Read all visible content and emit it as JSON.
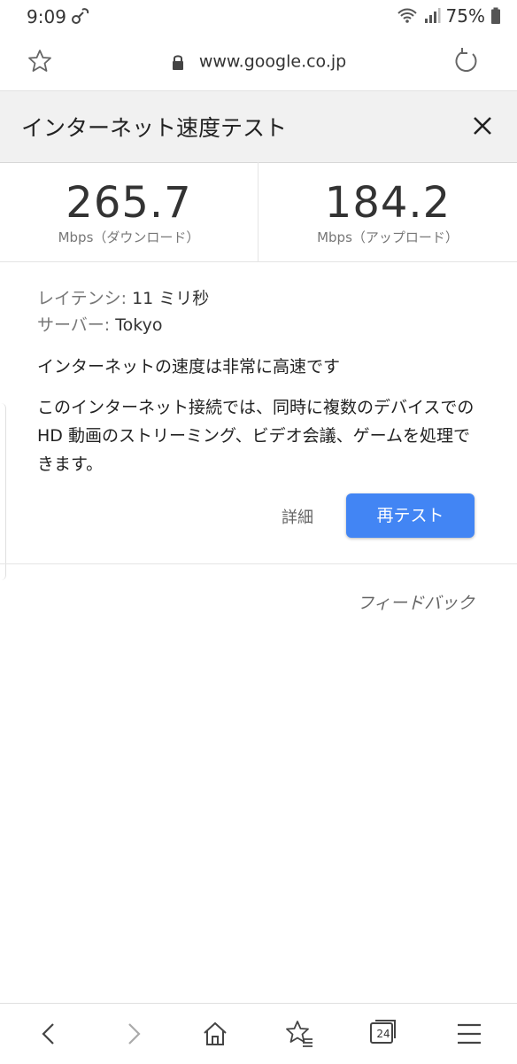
{
  "status_bar": {
    "time": "9:09",
    "battery": "75%"
  },
  "browser": {
    "url": "www.google.co.jp",
    "tab_count": "24"
  },
  "speed_test": {
    "title": "インターネット速度テスト",
    "download": {
      "value": "265.7",
      "label": "Mbps（ダウンロード）"
    },
    "upload": {
      "value": "184.2",
      "label": "Mbps（アップロード）"
    },
    "latency": {
      "key": "レイテンシ:",
      "value": " 11 ミリ秒"
    },
    "server": {
      "key": "サーバー:",
      "value": " Tokyo"
    },
    "rating": "インターネットの速度は非常に高速です",
    "description": "このインターネット接続では、同時に複数のデバイスでのHD 動画のストリーミング、ビデオ会議、ゲームを処理できます。",
    "details_label": "詳細",
    "retest_label": "再テスト",
    "feedback_label": "フィードバック"
  },
  "colors": {
    "accent": "#4285f4",
    "title_band": "#f1f1f1"
  },
  "icons": {
    "status_link": "link-icon",
    "wifi": "wifi-icon",
    "signal": "signal-icon",
    "battery": "battery-icon",
    "star": "star-icon",
    "lock": "lock-icon",
    "reload": "reload-icon",
    "close": "close-icon",
    "back": "back-icon",
    "forward": "forward-icon",
    "home": "home-icon",
    "bookmarks": "bookmarks-icon",
    "tabs": "tabs-icon",
    "menu": "menu-icon"
  }
}
